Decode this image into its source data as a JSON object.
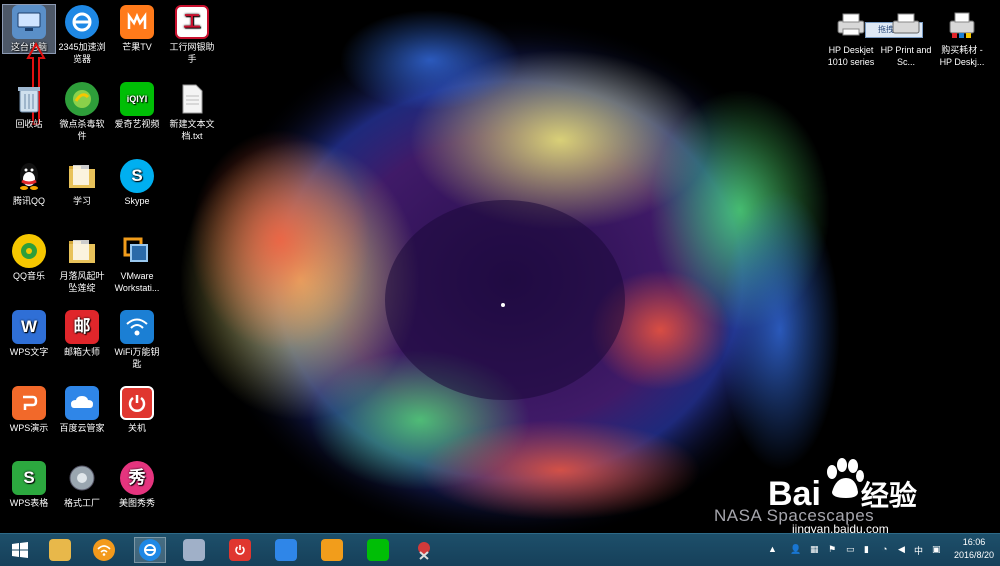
{
  "desktop": {
    "icons": [
      {
        "label": "这台电脑",
        "icon": "computer-icon",
        "color": "#5a8fc8"
      },
      {
        "label": "2345加速浏览器",
        "icon": "browser-2345-icon",
        "color": "#1e88e5"
      },
      {
        "label": "芒果TV",
        "icon": "mango-tv-icon",
        "color": "#ff7a1a"
      },
      {
        "label": "工行网银助手",
        "icon": "icbc-icon",
        "color": "#c8102e"
      },
      {
        "label": "回收站",
        "icon": "recycle-bin-icon",
        "color": "#9fb8d0"
      },
      {
        "label": "微点杀毒软件",
        "icon": "weidian-antivirus-icon",
        "color": "#2e9e3a"
      },
      {
        "label": "爱奇艺视频",
        "icon": "iqiyi-icon",
        "color": "#00be06"
      },
      {
        "label": "新建文本文档.txt",
        "icon": "text-file-icon",
        "color": "#f2f2f2"
      },
      {
        "label": "腾讯QQ",
        "icon": "qq-icon",
        "color": "#111111"
      },
      {
        "label": "学习",
        "icon": "folder-icon",
        "color": "#e8c25a"
      },
      {
        "label": "Skype",
        "icon": "skype-icon",
        "color": "#00aff0"
      },
      {
        "label": "QQ音乐",
        "icon": "qq-music-icon",
        "color": "#f6c700"
      },
      {
        "label": "月落风起叶坠莲绽",
        "icon": "folder-icon",
        "color": "#e8c25a"
      },
      {
        "label": "VMware Workstati...",
        "icon": "vmware-icon",
        "color": "#f29d1b"
      },
      {
        "label": "WPS文字",
        "icon": "wps-writer-icon",
        "color": "#2f6fd6"
      },
      {
        "label": "邮箱大师",
        "icon": "mail-master-icon",
        "color": "#e0262b"
      },
      {
        "label": "WiFi万能钥匙",
        "icon": "wifi-key-icon",
        "color": "#1b7fd4"
      },
      {
        "label": "WPS演示",
        "icon": "wps-presentation-icon",
        "color": "#f2692a"
      },
      {
        "label": "百度云管家",
        "icon": "baidu-cloud-icon",
        "color": "#2f86e8"
      },
      {
        "label": "关机",
        "icon": "shutdown-icon",
        "color": "#e0362f"
      },
      {
        "label": "WPS表格",
        "icon": "wps-spreadsheet-icon",
        "color": "#2ca83f"
      },
      {
        "label": "格式工厂",
        "icon": "format-factory-icon",
        "color": "#9aa6b0"
      },
      {
        "label": "美图秀秀",
        "icon": "meitu-icon",
        "color": "#e5347e"
      }
    ],
    "glyphs": {
      "wps_writer": "W",
      "mail_master": "邮",
      "wps_spreadsheet": "S",
      "meitu": "秀",
      "iqiyi": "iQIYI",
      "skype": "S",
      "icbc": "工"
    },
    "right_icons": [
      {
        "label": "HP Deskjet 1010 series",
        "icon": "printer-icon"
      },
      {
        "label": "HP Print and Sc...",
        "icon": "hp-print-scan-icon"
      },
      {
        "label": "购买耗材 - HP Deskj...",
        "icon": "printer-supplies-icon"
      }
    ],
    "upload_tooltip": "拖拽上传",
    "wallpaper_caption": "NASA Spacescapes"
  },
  "watermark": {
    "brand": "Bai",
    "brand_suffix": "经验",
    "url": "jingyan.baidu.com"
  },
  "taskbar": {
    "start": "windows-start-icon",
    "apps": [
      {
        "icon": "file-explorer-icon",
        "color": "#e8b84a"
      },
      {
        "icon": "wifi-key-icon",
        "color": "#f39a1c"
      },
      {
        "icon": "browser-2345-icon",
        "color": "#1e88e5"
      },
      {
        "icon": "paint-icon",
        "color": "#a0b0c8"
      },
      {
        "icon": "shutdown-icon",
        "color": "#e0362f"
      },
      {
        "icon": "baidu-cloud-icon",
        "color": "#2f86e8"
      },
      {
        "icon": "vmware-icon",
        "color": "#f29d1b"
      },
      {
        "icon": "iqiyi-icon",
        "color": "#00be06"
      },
      {
        "icon": "snipping-tool-icon",
        "color": "#d23a3a"
      }
    ],
    "tray": {
      "ime": "中",
      "time": "16:06",
      "date": "2016/8/20"
    }
  }
}
